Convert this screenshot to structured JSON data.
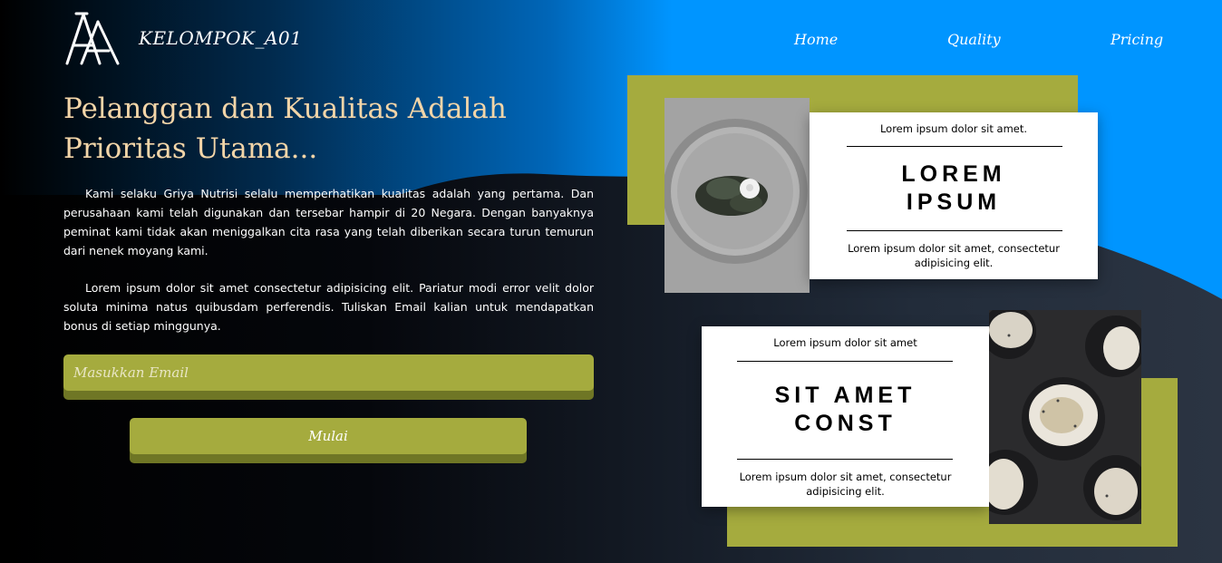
{
  "header": {
    "brand": "KELOMPOK_A01",
    "nav": [
      "Home",
      "Quality",
      "Pricing"
    ]
  },
  "hero": {
    "headline": "Pelanggan dan Kualitas Adalah Prioritas Utama...",
    "paragraph1": "Kami selaku Griya Nutrisi selalu memperhatikan kualitas adalah yang pertama. Dan perusahaan kami telah digunakan dan tersebar hampir di 20 Negara. Dengan banyaknya peminat kami tidak akan meniggalkan cita rasa yang telah diberikan secara turun temurun dari nenek moyang kami.",
    "paragraph2": "Lorem ipsum dolor sit amet consectetur adipisicing elit. Pariatur modi error velit dolor soluta minima natus quibusdam perferendis. Tuliskan Email kalian untuk mendapatkan bonus di setiap minggunya.",
    "email_placeholder": "Masukkan Email",
    "button_label": "Mulai"
  },
  "cards": [
    {
      "top_text": "Lorem ipsum dolor sit amet.",
      "title_line1": "LOREM",
      "title_line2": "IPSUM",
      "description": "Lorem ipsum dolor sit amet, consectetur adipisicing elit."
    },
    {
      "top_text": "Lorem ipsum dolor sit amet",
      "title_line1": "SIT AMET",
      "title_line2": "CONST",
      "description": "Lorem ipsum dolor sit amet, consectetur adipisicing elit."
    }
  ],
  "colors": {
    "accent_olive": "#a5ab3e",
    "headline": "#f3d5a8",
    "blue": "#0095ff"
  }
}
